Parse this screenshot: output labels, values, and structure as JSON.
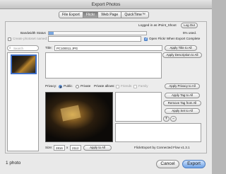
{
  "window": {
    "title": "Export Photos"
  },
  "tabs": [
    {
      "label": "File Export",
      "active": false
    },
    {
      "label": "Flickr",
      "active": true
    },
    {
      "label": "Web Page",
      "active": false
    },
    {
      "label": "QuickTime™",
      "active": false
    }
  ],
  "account": {
    "logged_in_text": "Logged in as iPoint_Shoot",
    "logout_label": "Log Out",
    "bandwidth_label": "Bandwidth Status",
    "bandwidth_used": "5% used.",
    "open_flickr_label": "Open Flickr When Export Complete",
    "open_flickr_checked": true,
    "create_photoset_label": "Create photoset named:",
    "create_photoset_checked": false
  },
  "search": {
    "placeholder": "Search"
  },
  "photo": {
    "title_label": "Title:",
    "title_value": "PC100011.JPG",
    "apply_title_label": "Apply Title to All",
    "apply_description_label": "Apply Description to All"
  },
  "privacy": {
    "label": "Privacy:",
    "options": [
      {
        "label": "Public",
        "selected": true,
        "enabled": true
      },
      {
        "label": "Private",
        "selected": false,
        "enabled": true
      }
    ],
    "allows_label": "Private allows:",
    "allow_options": [
      {
        "label": "Friends",
        "enabled": false
      },
      {
        "label": "Family",
        "enabled": false
      }
    ],
    "apply_privacy_label": "Apply Privacy to All"
  },
  "tags": {
    "apply_tag_label": "Apply Tag to All",
    "remove_tag_label": "Remove Tag from All",
    "apply_set_label": "Apply Set to All",
    "add_symbol": "+",
    "remove_symbol": "−"
  },
  "size": {
    "label": "Size:",
    "width": "2816",
    "times": "x",
    "height": "2112",
    "apply_label": "Apply to All"
  },
  "credit": "FlickrExport by Connected Flow v1.3.1",
  "footer": {
    "count": "1 photo",
    "cancel_label": "Cancel",
    "export_label": "Export"
  },
  "colors": {
    "accent": "#6ea2e6",
    "active_tab": "#8c8c8c"
  }
}
